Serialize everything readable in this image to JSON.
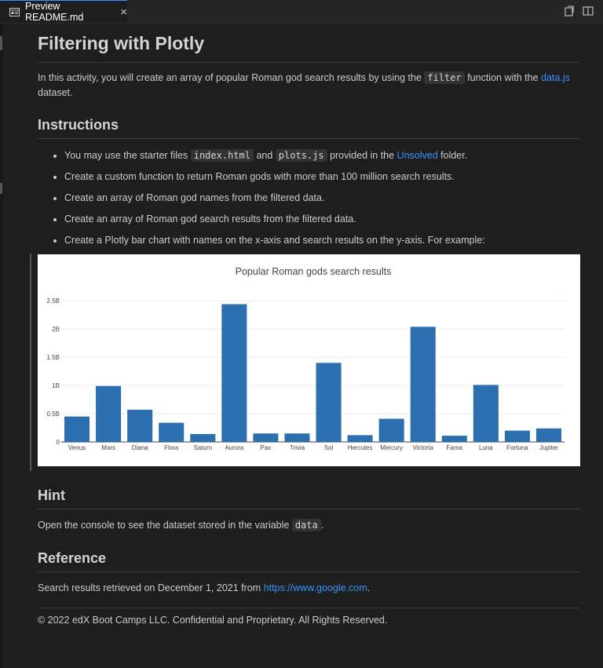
{
  "tab": {
    "label": "Preview README.md",
    "close": "×"
  },
  "h1": "Filtering with Plotly",
  "intro": {
    "before": "In this activity, you will create an array of popular Roman god search results by using the ",
    "code": "filter",
    "middle": " function with the ",
    "link": "data.js",
    "after": " dataset."
  },
  "instructions": {
    "heading": "Instructions",
    "item1": {
      "before": "You may use the starter files ",
      "code1": "index.html",
      "and": " and ",
      "code2": "plots.js",
      "middle": " provided in the ",
      "link": "Unsolved",
      "after": " folder."
    },
    "item2": "Create a custom function to return Roman gods with more than 100 million search results.",
    "item3": "Create an array of Roman god names from the filtered data.",
    "item4": "Create an array of Roman god search results from the filtered data.",
    "item5": "Create a Plotly bar chart with names on the x-axis and search results on the y-axis. For example:"
  },
  "hint": {
    "heading": "Hint",
    "before": "Open the console to see the dataset stored in the variable ",
    "code": "data",
    "after": "."
  },
  "reference": {
    "heading": "Reference",
    "before": "Search results retrieved on December 1, 2021 from ",
    "link": "https://www.google.com",
    "after": "."
  },
  "footer": "© 2022 edX Boot Camps LLC. Confidential and Proprietary. All Rights Reserved.",
  "colors": {
    "bar": "#2c6fb1",
    "link": "#3794ff",
    "accent_tab": "#3794ff"
  },
  "chart_data": {
    "type": "bar",
    "title": "Popular Roman gods search results",
    "categories": [
      "Venus",
      "Mars",
      "Diana",
      "Flora",
      "Saturn",
      "Aurora",
      "Pax",
      "Trivia",
      "Sol",
      "Hercules",
      "Mercury",
      "Victoria",
      "Fama",
      "Luna",
      "Fortuna",
      "Jupiter"
    ],
    "values": [
      450000000,
      990000000,
      570000000,
      340000000,
      140000000,
      2440000000,
      150000000,
      150000000,
      1400000000,
      120000000,
      410000000,
      2040000000,
      110000000,
      1010000000,
      200000000,
      240000000
    ],
    "yticks": [
      "0",
      "0.5B",
      "1B",
      "1.5B",
      "2B",
      "2.5B"
    ],
    "ylim": [
      0,
      2600000000
    ],
    "xlabel": "",
    "ylabel": "",
    "grid": true
  }
}
